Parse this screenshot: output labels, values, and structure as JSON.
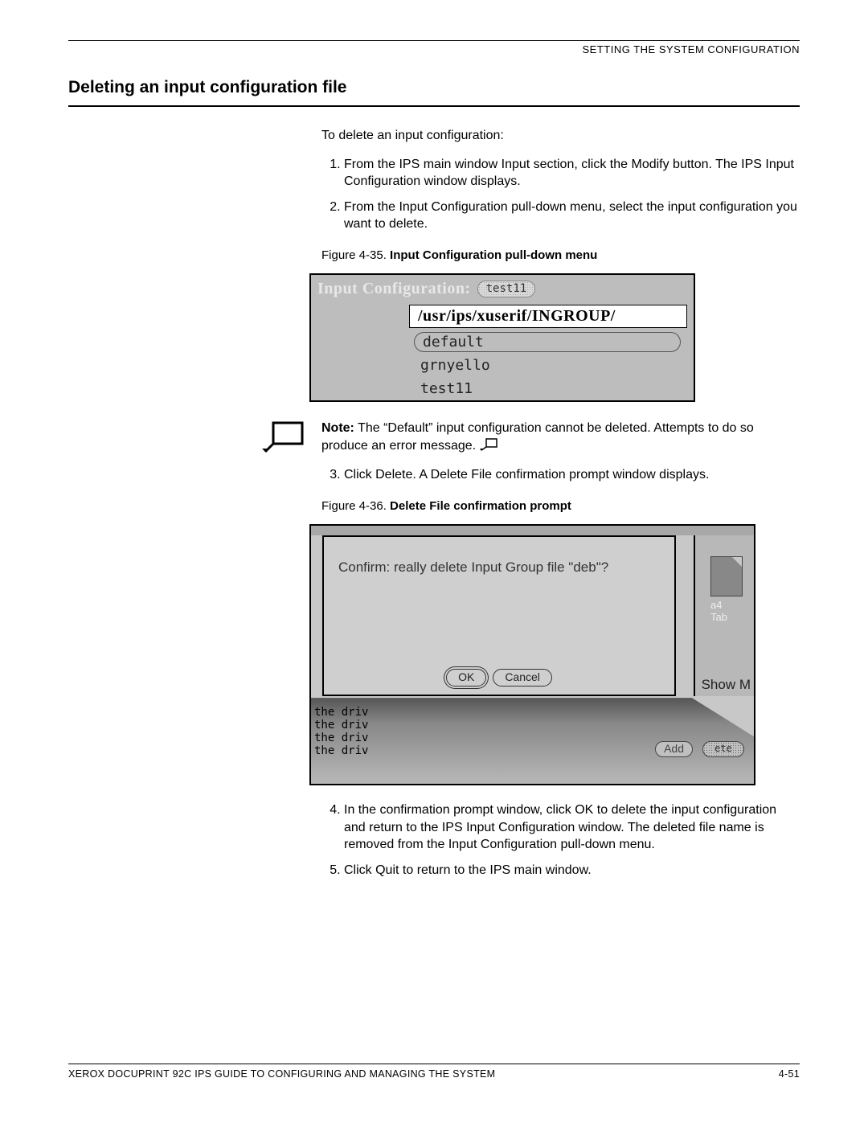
{
  "header": "SETTING THE SYSTEM CONFIGURATION",
  "section_title": "Deleting an input configuration file",
  "intro": "To delete an input configuration:",
  "steps_a": [
    "From the IPS main window Input section, click the Modify button. The IPS Input Configuration window displays.",
    "From the Input Configuration pull-down menu, select the input configuration you want to delete."
  ],
  "fig1": {
    "caption_prefix": "Figure 4-35.  ",
    "caption_bold": "Input Configuration pull-down menu",
    "titlebar": "Input Configuration:",
    "chip": "test11",
    "menu_header": "/usr/ips/xuserif/INGROUP/",
    "options": [
      "default",
      "grnyello",
      "test11"
    ]
  },
  "note": {
    "label": "Note:",
    "text": "  The “Default” input configuration cannot be deleted. Attempts to do so produce an error message.  "
  },
  "steps_b_start": 3,
  "steps_b": [
    "Click Delete. A Delete File confirmation prompt window displays."
  ],
  "fig2": {
    "caption_prefix": "Figure 4-36.  ",
    "caption_bold": "Delete File confirmation prompt",
    "message": "Confirm: really delete Input Group file \"deb\"?",
    "ok": "OK",
    "cancel": "Cancel",
    "paper_label_1": "a4",
    "paper_label_2": "Tab",
    "show_m": "Show M",
    "textlines": [
      "the driv",
      "the driv",
      "the driv",
      "the driv"
    ],
    "add_btn": "Add",
    "del_btn": "ete"
  },
  "steps_c_start": 4,
  "steps_c": [
    "In the confirmation prompt window, click OK to delete the input configuration and return to the IPS Input Configuration window. The deleted file name is removed from the Input Configuration pull-down menu.",
    "Click Quit to return to the IPS main window."
  ],
  "footer_left": "XEROX DOCUPRINT 92C IPS GUIDE TO CONFIGURING AND MANAGING THE SYSTEM",
  "footer_right": "4-51"
}
